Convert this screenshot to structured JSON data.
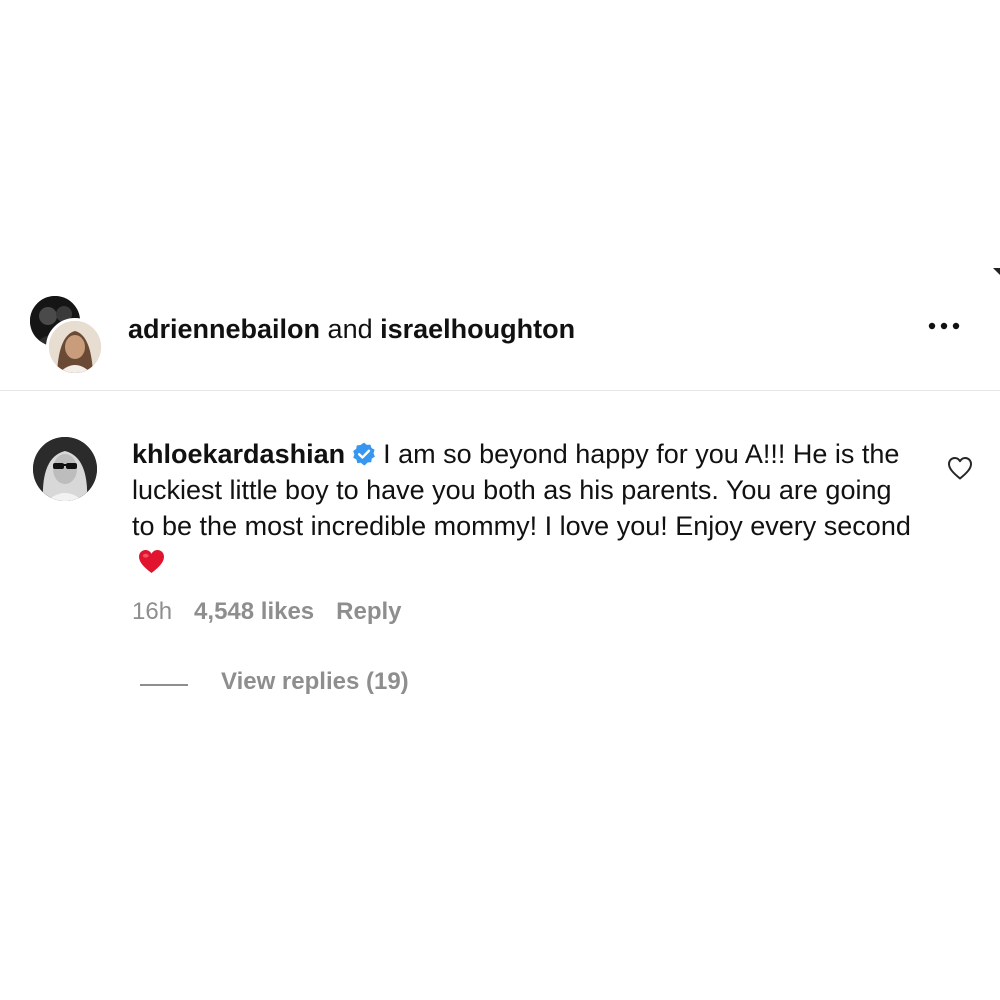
{
  "post": {
    "author1": "adriennebailon",
    "joiner": " and ",
    "author2": "israelhoughton"
  },
  "comment": {
    "username": "khloekardashian",
    "text": "I am so beyond happy for you A!!! He is the luckiest little boy to have you both as his parents. You are going to be the most incredible mommy! I love you! Enjoy every second",
    "time": "16h",
    "likes": "4,548 likes",
    "reply_label": "Reply",
    "view_replies": "View replies (19)"
  },
  "colors": {
    "verified": "#3797f0",
    "heart": "#e0142e",
    "secondary_text": "#8e8e8e"
  },
  "icons": [
    "more-icon",
    "verified-badge-icon",
    "red-heart-emoji",
    "heart-outline-icon"
  ]
}
